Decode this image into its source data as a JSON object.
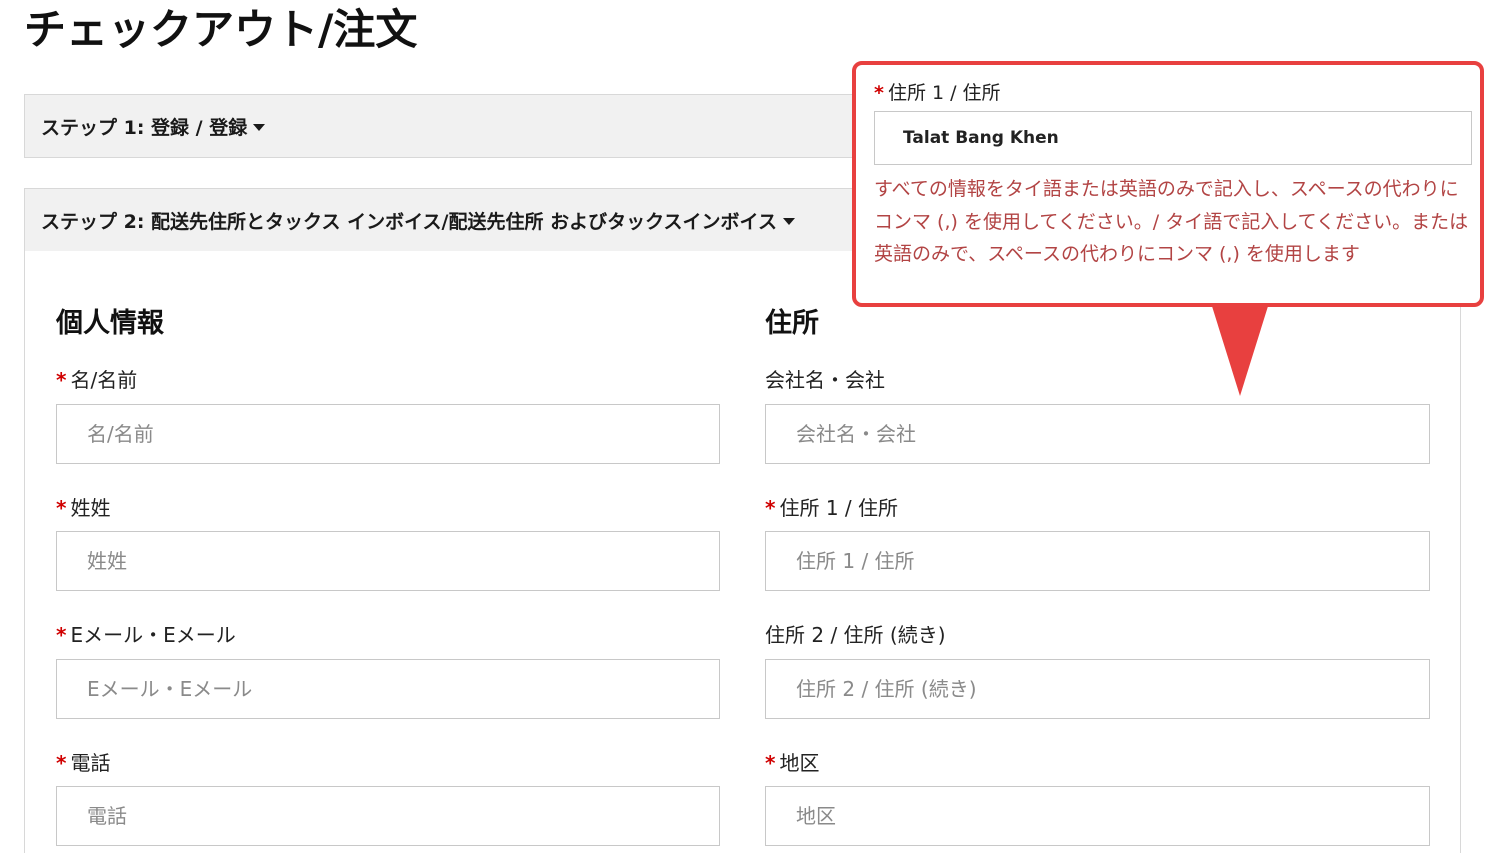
{
  "page": {
    "title": "チェックアウト/注文"
  },
  "steps": [
    {
      "label": "ステップ 1: 登録 / 登録"
    },
    {
      "label": "ステップ 2: 配送先住所とタックス インボイス/配送先住所 およびタックスインボイス"
    }
  ],
  "personal": {
    "heading": "個人情報",
    "first_name": {
      "label": "名/名前",
      "placeholder": "名/名前",
      "required": "*"
    },
    "last_name": {
      "label": "姓姓",
      "placeholder": "姓姓",
      "required": "*"
    },
    "email": {
      "label": "Eメール・Eメール",
      "placeholder": "Eメール・Eメール",
      "required": "*"
    },
    "phone": {
      "label": "電話",
      "placeholder": "電話",
      "required": "*"
    }
  },
  "address": {
    "heading": "住所",
    "company": {
      "label": "会社名・会社",
      "placeholder": "会社名・会社"
    },
    "address1": {
      "label": "住所 1 / 住所",
      "placeholder": "住所 1 / 住所",
      "required": "*"
    },
    "address2": {
      "label": "住所 2 / 住所 (続き)",
      "placeholder": "住所 2 / 住所 (続き)"
    },
    "district": {
      "label": "地区",
      "placeholder": "地区",
      "required": "*"
    }
  },
  "callout": {
    "required": "*",
    "label": "住所 1 / 住所",
    "value": "Talat Bang Khen",
    "error": "すべての情報をタイ語または英語のみで記入し、スペースの代わりにコンマ (,) を使用してください。/ タイ語で記入してください。または英語のみで、スペースの代わりにコンマ (,) を使用します",
    "accent_color": "#e8403f"
  }
}
